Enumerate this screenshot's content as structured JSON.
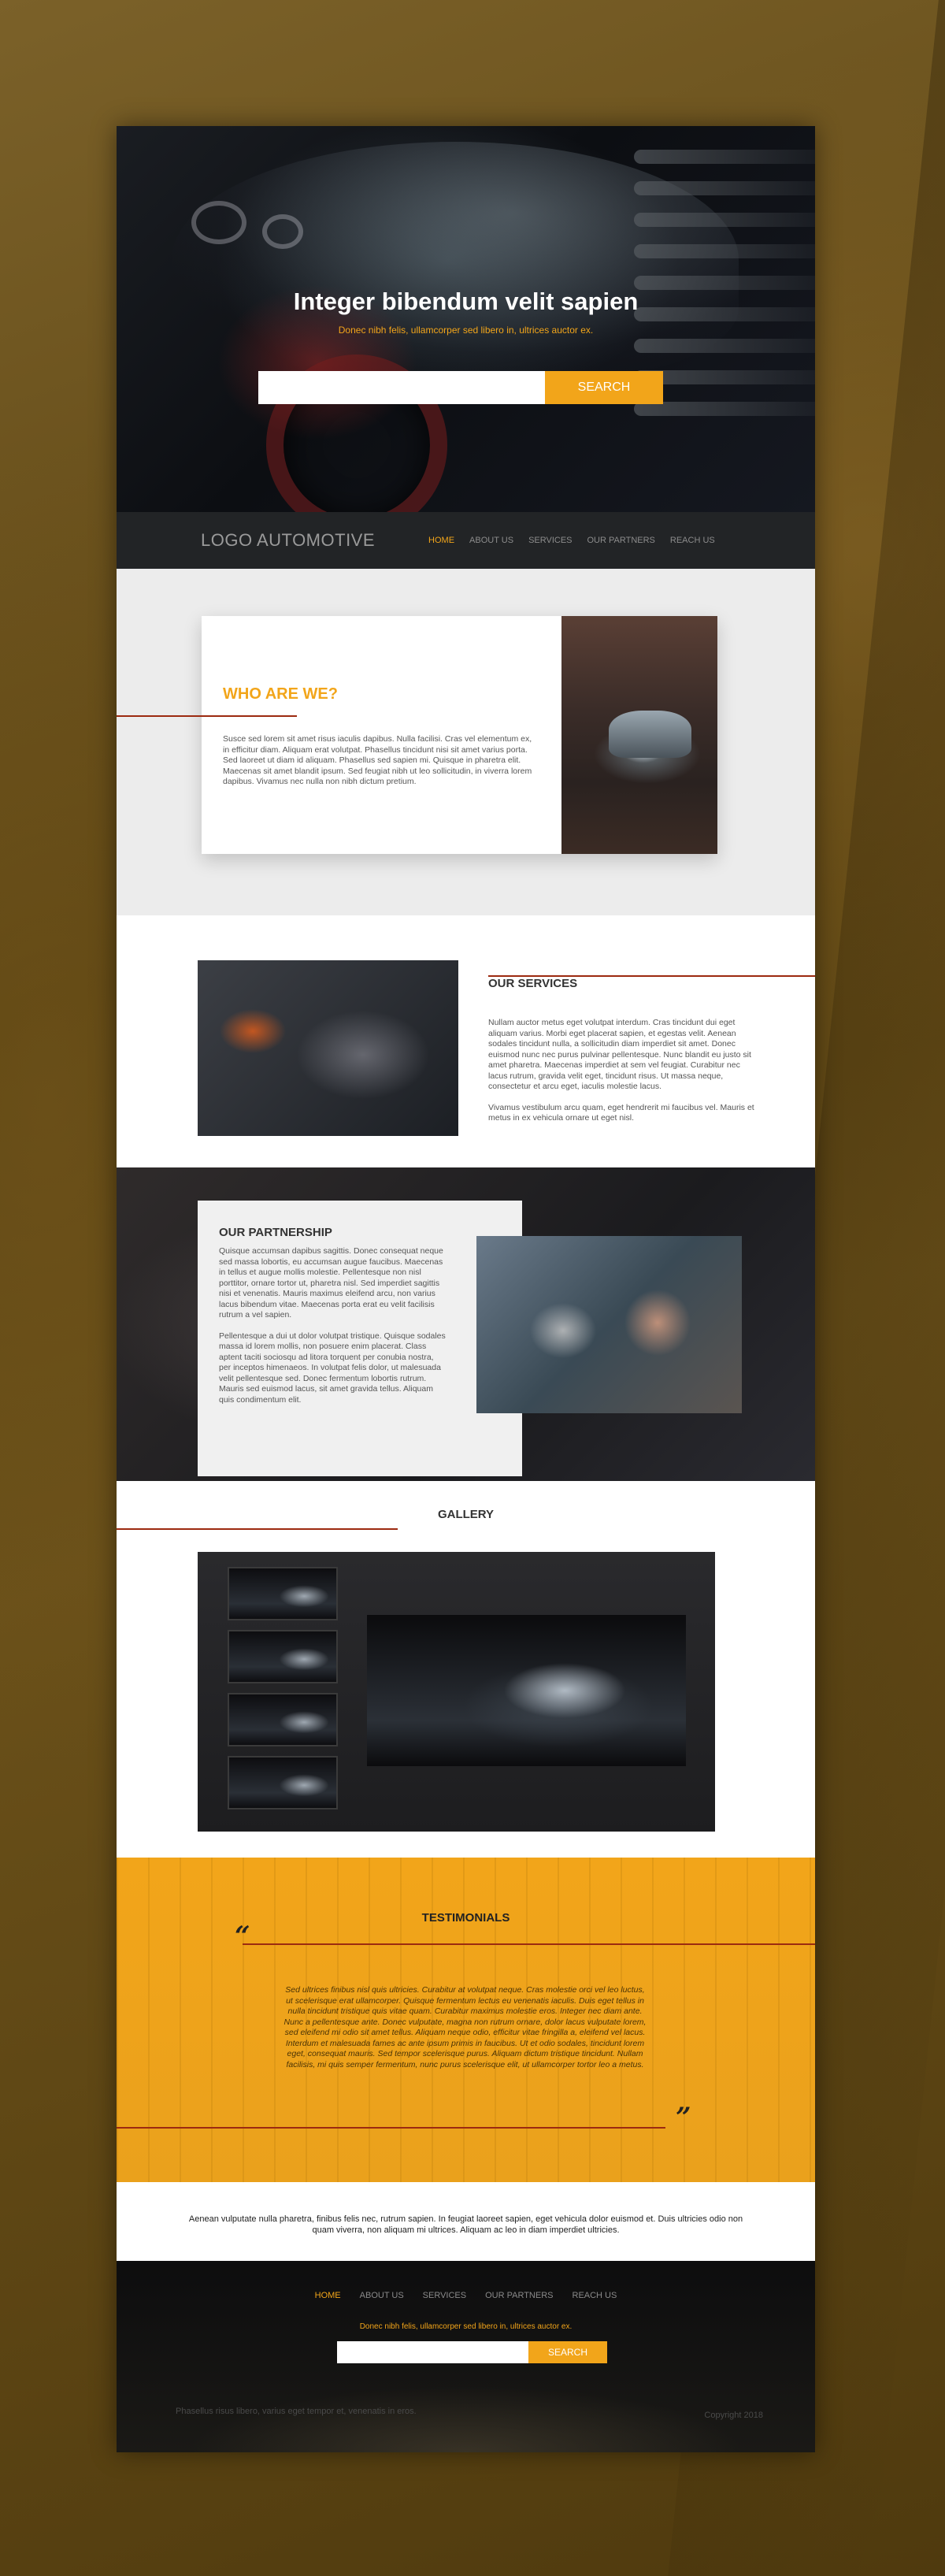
{
  "hero": {
    "title": "Integer bibendum velit sapien",
    "subtitle": "Donec nibh felis, ullamcorper sed libero in, ultrices auctor ex.",
    "search_placeholder": "",
    "search_button": "SEARCH"
  },
  "nav": {
    "logo": "LOGO AUTOMOTIVE",
    "links": [
      "HOME",
      "ABOUT US",
      "SERVICES",
      "OUR PARTNERS",
      "REACH US"
    ]
  },
  "who": {
    "title": "WHO ARE WE?",
    "text": "Susce sed lorem sit amet risus iaculis dapibus. Nulla facilisi. Cras vel elementum ex, in efficitur diam. Aliquam erat volutpat. Phasellus tincidunt nisi sit amet varius porta. Sed laoreet ut diam id aliquam. Phasellus sed sapien mi. Quisque in pharetra elit. Maecenas sit amet blandit ipsum. Sed feugiat nibh ut leo sollicitudin, in viverra lorem dapibus. Vivamus nec nulla non nibh dictum pretium."
  },
  "services": {
    "title": "OUR SERVICES",
    "p1": "Nullam auctor metus eget volutpat interdum. Cras tincidunt dui eget aliquam varius. Morbi eget placerat sapien, et egestas velit. Aenean sodales tincidunt nulla, a sollicitudin diam imperdiet sit amet. Donec euismod nunc nec purus pulvinar pellentesque. Nunc blandit eu justo sit amet pharetra. Maecenas imperdiet at sem vel feugiat. Curabitur nec lacus rutrum, gravida velit eget, tincidunt risus. Ut massa neque, consectetur et arcu eget, iaculis molestie lacus.",
    "p2": "Vivamus vestibulum arcu quam, eget hendrerit mi faucibus vel. Mauris et metus in ex vehicula ornare ut eget nisl."
  },
  "partnership": {
    "title": "OUR PARTNERSHIP",
    "p1": "Quisque accumsan dapibus sagittis. Donec consequat neque sed massa lobortis, eu accumsan augue faucibus. Maecenas in tellus et augue mollis molestie. Pellentesque non nisl porttitor, ornare tortor ut, pharetra nisl. Sed imperdiet sagittis nisi et venenatis. Mauris maximus eleifend arcu, non varius lacus bibendum vitae. Maecenas porta erat eu velit facilisis rutrum a vel sapien.",
    "p2": "Pellentesque a dui ut dolor volutpat tristique. Quisque sodales massa id lorem mollis, non posuere enim placerat. Class aptent taciti sociosqu ad litora torquent per conubia nostra, per inceptos himenaeos. In volutpat felis dolor, ut malesuada velit pellentesque sed. Donec fermentum lobortis rutrum. Mauris sed euismod lacus, sit amet gravida tellus. Aliquam quis condimentum elit."
  },
  "gallery": {
    "title": "GALLERY"
  },
  "testimonials": {
    "title": "TESTIMONIALS",
    "open_quote": "“",
    "close_quote": "”",
    "text": "Sed ultrices finibus nisl quis ultricies. Curabitur at volutpat neque. Cras molestie orci vel leo luctus, ut scelerisque erat ullamcorper. Quisque fermentum lectus eu venenatis iaculis. Duis eget tellus in nulla tincidunt tristique quis vitae quam. Curabitur maximus molestie eros. Integer nec diam ante. Nunc a pellentesque ante. Donec vulputate, magna non rutrum ornare, dolor lacus vulputate lorem, sed eleifend mi odio sit amet tellus. Aliquam neque odio, efficitur vitae fringilla a, eleifend vel lacus. Interdum et malesuada fames ac ante ipsum primis in faucibus. Ut et odio sodales, tincidunt lorem eget, consequat mauris. Sed tempor scelerisque purus. Aliquam dictum tristique tincidunt. Nullam facilisis, mi quis semper fermentum, nunc purus scelerisque elit, ut ullamcorper tortor leo a metus."
  },
  "bottom": {
    "text": "Aenean vulputate nulla pharetra, finibus felis nec, rutrum sapien. In feugiat laoreet sapien, eget vehicula dolor euismod et. Duis ultricies odio non quam viverra, non aliquam mi ultrices. Aliquam ac leo in diam imperdiet ultricies."
  },
  "footer": {
    "links": [
      "HOME",
      "ABOUT US",
      "SERVICES",
      "OUR PARTNERS",
      "REACH US"
    ],
    "subtitle": "Donec nibh felis, ullamcorper sed libero in, ultrices auctor ex.",
    "search_placeholder": "",
    "search_button": "SEARCH",
    "left_text": "Phasellus risus libero, varius eget tempor et, venenatis in eros.",
    "copyright": "Copyright 2018"
  },
  "colors": {
    "accent": "#f2a51a",
    "rule": "#9c2a10",
    "nav_bg": "#222426"
  }
}
